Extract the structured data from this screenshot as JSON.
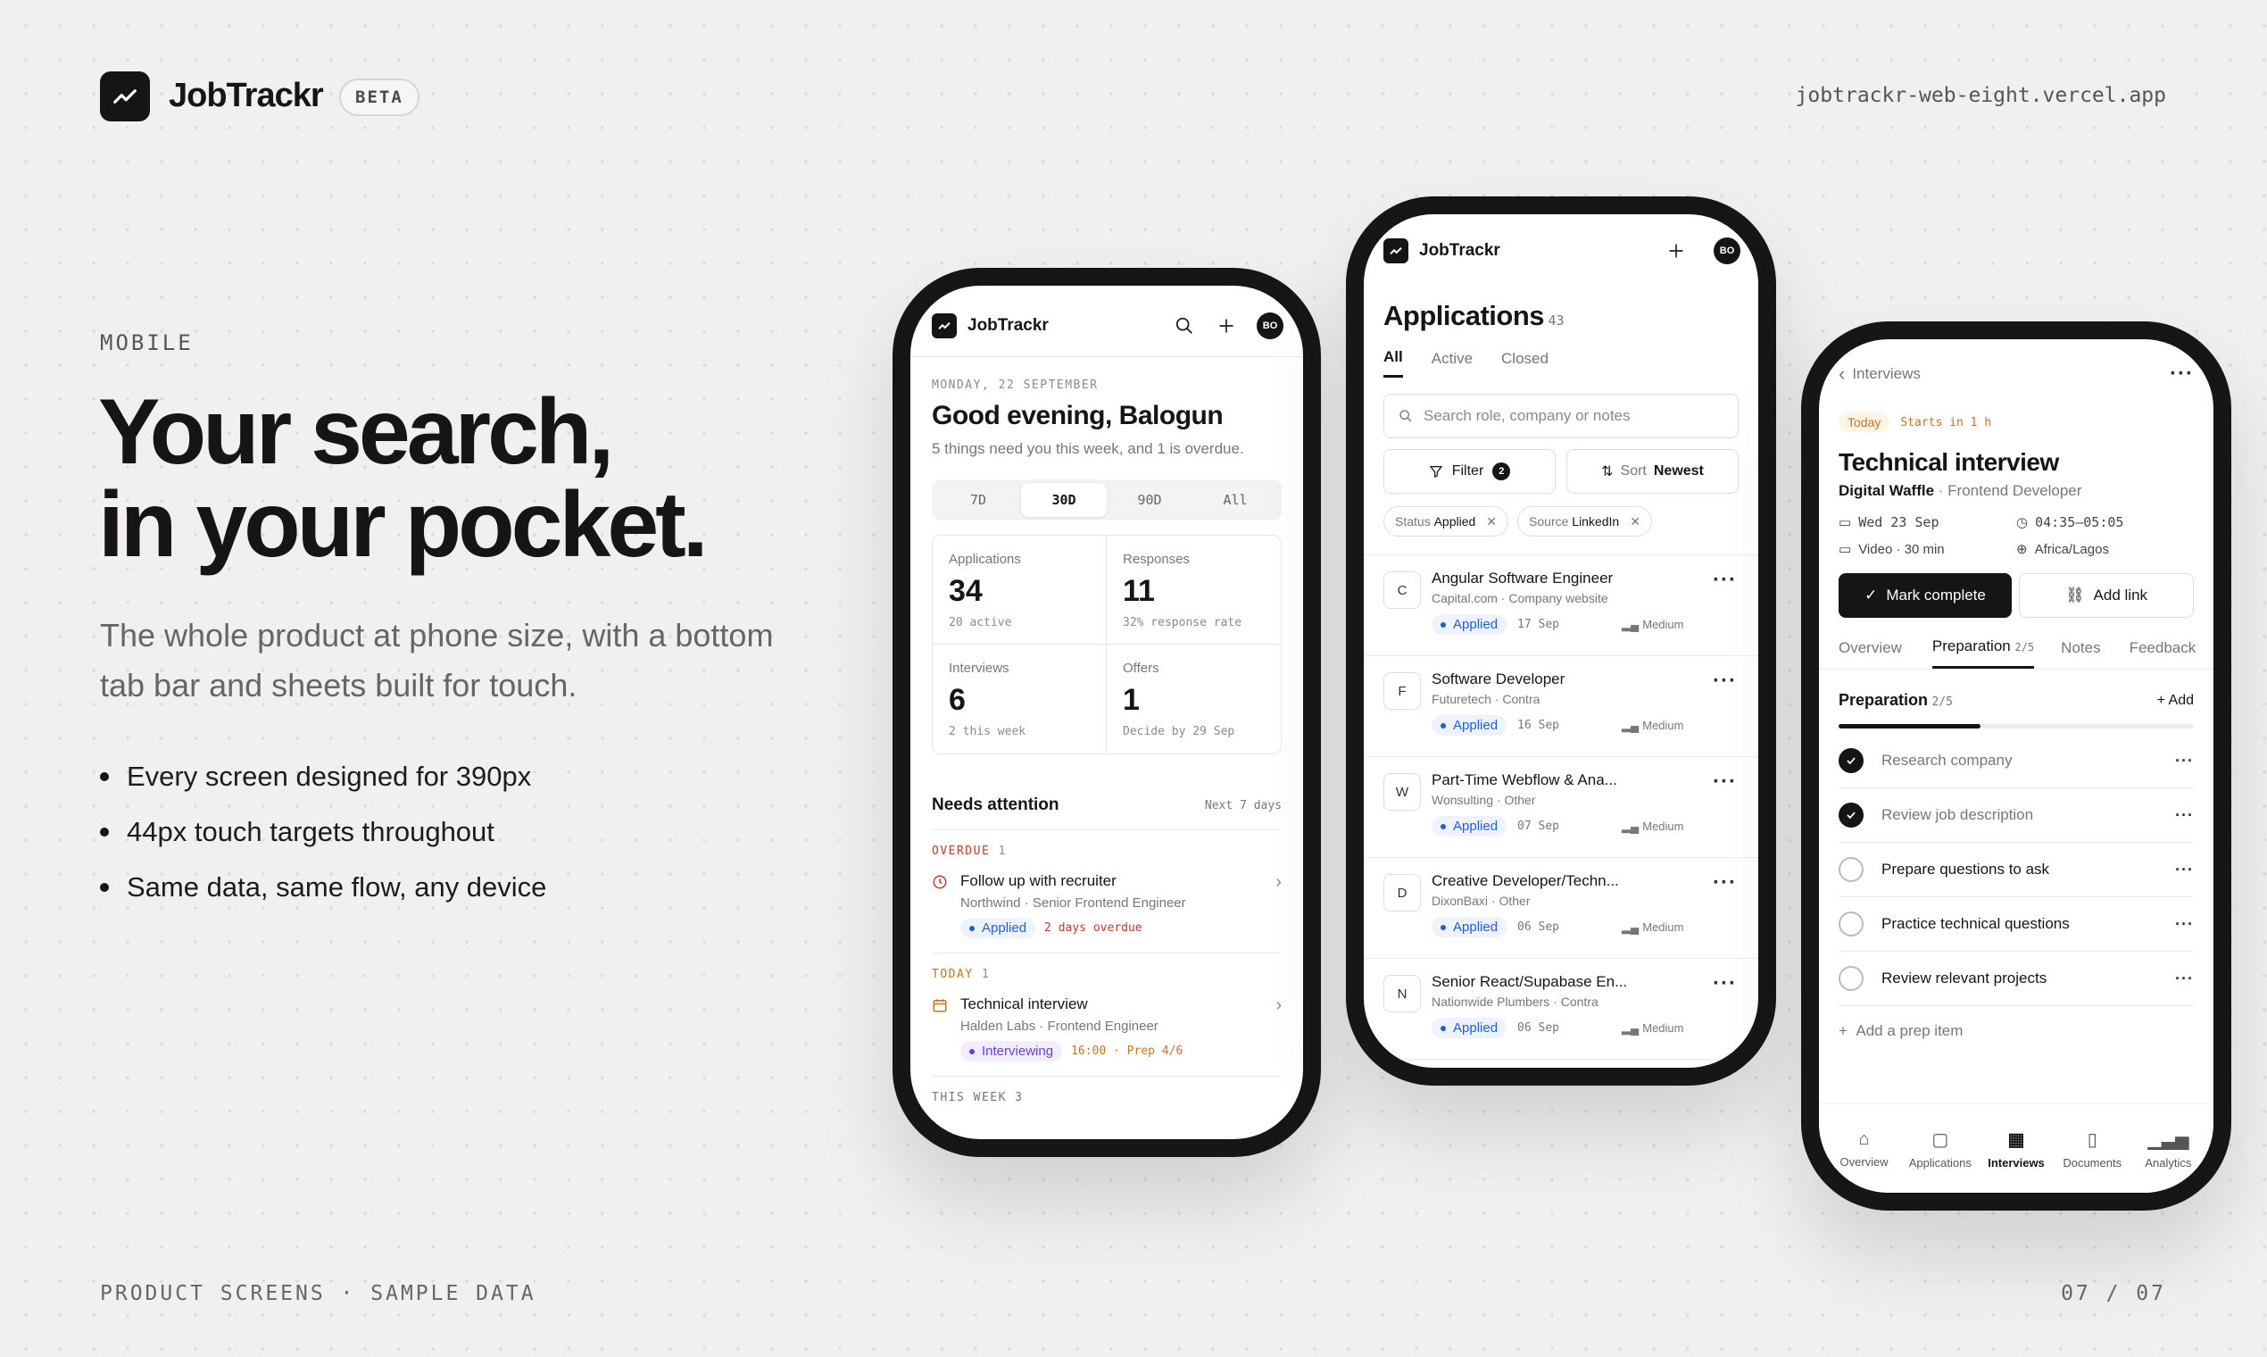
{
  "header": {
    "brand": "JobTrackr",
    "badge": "BETA",
    "url": "jobtrackr-web-eight.vercel.app"
  },
  "hero": {
    "eyebrow": "MOBILE",
    "line1": "Your search,",
    "line2": "in your pocket.",
    "subtitle": "The whole product at phone size, with a bottom tab bar and sheets built for touch.",
    "bullets": [
      "Every screen designed for 390px",
      "44px touch targets throughout",
      "Same data, same flow, any device"
    ]
  },
  "footer": {
    "left": "PRODUCT SCREENS · SAMPLE DATA",
    "page": "07 / 07"
  },
  "phone1": {
    "app": "JobTrackr",
    "avatar": "BO",
    "date": "MONDAY, 22 SEPTEMBER",
    "greeting": "Good evening, Balogun",
    "summary": "5 things need you this week, and 1 is overdue.",
    "ranges": [
      "7D",
      "30D",
      "90D",
      "All"
    ],
    "selected_range": "30D",
    "stats": [
      {
        "label": "Applications",
        "value": "34",
        "note": "20 active"
      },
      {
        "label": "Responses",
        "value": "11",
        "note": "32% response rate"
      },
      {
        "label": "Interviews",
        "value": "6",
        "note": "2 this week"
      },
      {
        "label": "Offers",
        "value": "1",
        "note": "Decide by 29 Sep"
      }
    ],
    "attention_title": "Needs attention",
    "attention_range": "Next 7 days",
    "overdue_label": "OVERDUE",
    "overdue_count": "1",
    "item1": {
      "title": "Follow up with recruiter",
      "sub": "Northwind · Senior Frontend Engineer",
      "chip": "Applied",
      "meta": "2 days overdue"
    },
    "today_label": "TODAY",
    "today_count": "1",
    "item2": {
      "title": "Technical interview",
      "sub": "Halden Labs · Frontend Engineer",
      "chip": "Interviewing",
      "meta": "16:00 · Prep 4/6"
    },
    "week_label": "THIS WEEK",
    "week_count": "3"
  },
  "phone2": {
    "app": "JobTrackr",
    "avatar": "BO",
    "title": "Applications",
    "count": "43",
    "tabs": [
      "All",
      "Active",
      "Closed"
    ],
    "search_placeholder": "Search role, company or notes",
    "filter_label": "Filter",
    "filter_count": "2",
    "sort_label": "Sort",
    "sort_value": "Newest",
    "pills": [
      {
        "key": "Status",
        "value": "Applied"
      },
      {
        "key": "Source",
        "value": "LinkedIn"
      }
    ],
    "rows": [
      {
        "letter": "C",
        "title": "Angular Software Engineer",
        "sub": "Capital.com · Company website",
        "status": "Applied",
        "date": "17 Sep",
        "priority": "Medium"
      },
      {
        "letter": "F",
        "title": "Software Developer",
        "sub": "Futuretech · Contra",
        "status": "Applied",
        "date": "16 Sep",
        "priority": "Medium"
      },
      {
        "letter": "W",
        "title": "Part-Time Webflow & Ana...",
        "sub": "Wonsulting · Other",
        "status": "Applied",
        "date": "07 Sep",
        "priority": "Medium"
      },
      {
        "letter": "D",
        "title": "Creative Developer/Techn...",
        "sub": "DixonBaxi · Other",
        "status": "Applied",
        "date": "06 Sep",
        "priority": "Medium"
      },
      {
        "letter": "N",
        "title": "Senior React/Supabase En...",
        "sub": "Nationwide Plumbers · Contra",
        "status": "Applied",
        "date": "06 Sep",
        "priority": "Medium"
      }
    ]
  },
  "phone3": {
    "back": "Interviews",
    "today": "Today",
    "starts": "Starts in 1 h",
    "title": "Technical interview",
    "company": "Digital Waffle",
    "role": "· Frontend Developer",
    "date": "Wed 23 Sep",
    "time": "04:35–05:05",
    "mode": "Video · 30 min",
    "tz": "Africa/Lagos",
    "primary": "Mark complete",
    "secondary": "Add link",
    "tabs": [
      "Overview",
      "Preparation",
      "Notes",
      "Feedback"
    ],
    "tab_badge": "2/5",
    "prep_title": "Preparation",
    "prep_count": "2/5",
    "add": "Add",
    "progress": 0.4,
    "tasks": [
      {
        "label": "Research company",
        "done": true
      },
      {
        "label": "Review job description",
        "done": true
      },
      {
        "label": "Prepare questions to ask",
        "done": false
      },
      {
        "label": "Practice technical questions",
        "done": false
      },
      {
        "label": "Review relevant projects",
        "done": false
      }
    ],
    "add_item": "Add a prep item",
    "nav": [
      "Overview",
      "Applications",
      "Interviews",
      "Documents",
      "Analytics"
    ],
    "nav_active": "Interviews"
  },
  "colors": {
    "ink": "#151515",
    "applied": "#1f5fd6",
    "interviewing": "#6a3fd8",
    "overdue": "#c0392b",
    "today": "#c9731b"
  }
}
